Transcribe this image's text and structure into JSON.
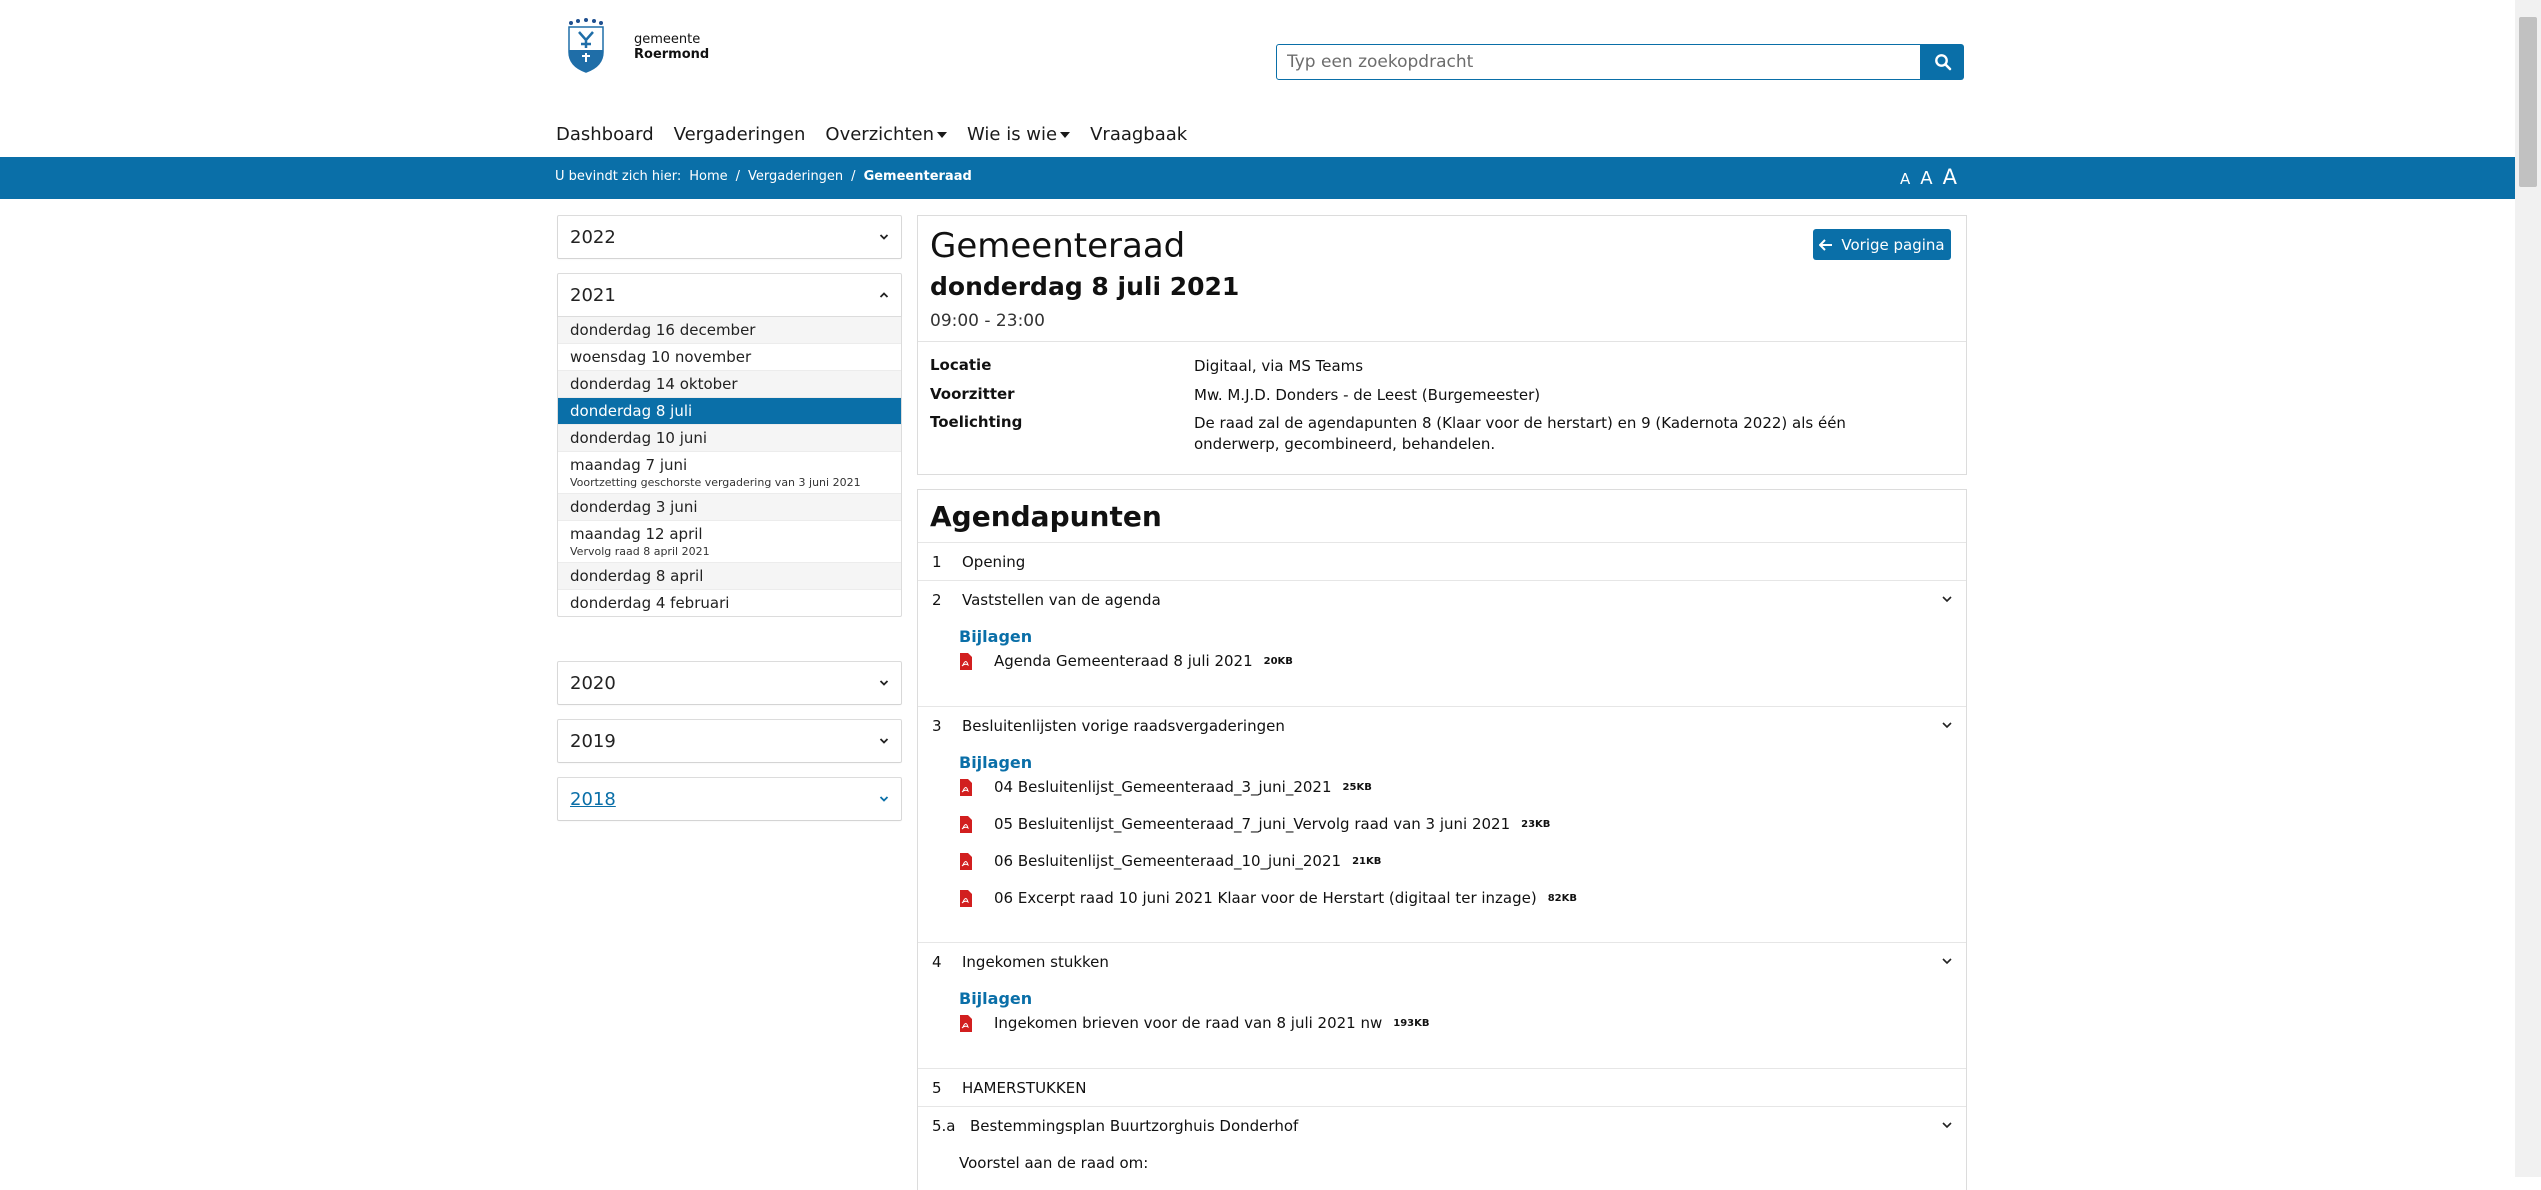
{
  "header": {
    "logo_prefix": "gemeente",
    "logo_name": "Roermond",
    "search_placeholder": "Typ een zoekopdracht",
    "nav": [
      {
        "label": "Dashboard",
        "dropdown": false
      },
      {
        "label": "Vergaderingen",
        "dropdown": false
      },
      {
        "label": "Overzichten",
        "dropdown": true
      },
      {
        "label": "Wie is wie",
        "dropdown": true
      },
      {
        "label": "Vraagbaak",
        "dropdown": false
      }
    ]
  },
  "breadcrumb": {
    "prefix": "U bevindt zich hier:",
    "items": [
      "Home",
      "Vergaderingen",
      "Gemeenteraad"
    ],
    "sep": "/"
  },
  "font_sizes": [
    "A",
    "A",
    "A"
  ],
  "sidebar": {
    "years": [
      {
        "label": "2022",
        "expanded": false
      },
      {
        "label": "2021",
        "expanded": true
      },
      {
        "label": "2020",
        "expanded": false
      },
      {
        "label": "2019",
        "expanded": false
      },
      {
        "label": "2018",
        "expanded": false
      }
    ],
    "meetings_2021": [
      {
        "label": "donderdag 16 december",
        "sub": ""
      },
      {
        "label": "woensdag 10 november",
        "sub": ""
      },
      {
        "label": "donderdag 14 oktober",
        "sub": ""
      },
      {
        "label": "donderdag 8 juli",
        "sub": "",
        "selected": true
      },
      {
        "label": "donderdag 10 juni",
        "sub": ""
      },
      {
        "label": "maandag 7 juni",
        "sub": "Voortzetting geschorste vergadering van 3 juni 2021"
      },
      {
        "label": "donderdag 3 juni",
        "sub": ""
      },
      {
        "label": "maandag 12 april",
        "sub": "Vervolg raad 8 april 2021"
      },
      {
        "label": "donderdag 8 april",
        "sub": ""
      },
      {
        "label": "donderdag 4 februari",
        "sub": ""
      }
    ]
  },
  "meeting": {
    "title": "Gemeenteraad",
    "date": "donderdag 8 juli 2021",
    "time": "09:00 - 23:00",
    "back_label": "Vorige pagina",
    "details": [
      {
        "key": "Locatie",
        "value": "Digitaal, via MS Teams"
      },
      {
        "key": "Voorzitter",
        "value": "Mw. M.J.D. Donders - de Leest (Burgemeester)"
      },
      {
        "key": "Toelichting",
        "value": "De raad zal de agendapunten 8 (Klaar voor de herstart) en 9 (Kadernota 2022) als één onderwerp, gecombineerd, behandelen."
      }
    ]
  },
  "agenda": {
    "heading": "Agendapunten",
    "attachments_label": "Bijlagen",
    "items": [
      {
        "num": "1",
        "title": "Opening"
      },
      {
        "num": "2",
        "title": "Vaststellen van de agenda",
        "files": [
          {
            "name": "Agenda Gemeenteraad 8 juli 2021",
            "size": "20KB"
          }
        ]
      },
      {
        "num": "3",
        "title": "Besluitenlijsten vorige raadsvergaderingen",
        "files": [
          {
            "name": "04 Besluitenlijst_Gemeenteraad_3_juni_2021",
            "size": "25KB"
          },
          {
            "name": "05 Besluitenlijst_Gemeenteraad_7_juni_Vervolg raad van 3 juni 2021",
            "size": "23KB"
          },
          {
            "name": "06 Besluitenlijst_Gemeenteraad_10_juni_2021",
            "size": "21KB"
          },
          {
            "name": "06 Excerpt raad 10 juni 2021 Klaar voor de Herstart (digitaal ter inzage)",
            "size": "82KB"
          }
        ]
      },
      {
        "num": "4",
        "title": "Ingekomen stukken",
        "files": [
          {
            "name": "Ingekomen brieven voor de raad van 8 juli 2021 nw",
            "size": "193KB"
          }
        ]
      },
      {
        "num": "5",
        "title": "HAMERSTUKKEN"
      },
      {
        "num": "5.a",
        "title": "Bestemmingsplan Buurtzorghuis Donderhof",
        "note": "Voorstel aan de raad om:"
      }
    ]
  },
  "colors": {
    "brand": "#0a6fa8",
    "pdf": "#d21f1f"
  }
}
